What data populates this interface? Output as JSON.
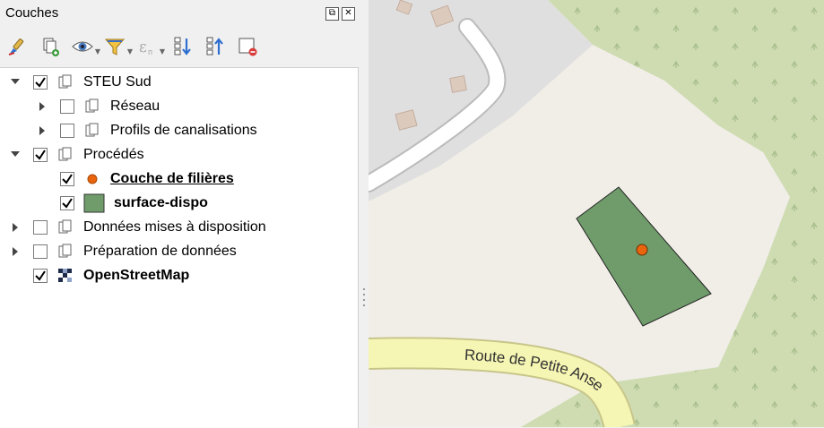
{
  "panel": {
    "title": "Couches",
    "float_button": "⧉",
    "close_button": "✕"
  },
  "toolbar": {
    "buttons": [
      {
        "icon": "style-brush-icon"
      },
      {
        "icon": "add-group-icon"
      },
      {
        "icon": "eye-visibility-icon"
      },
      {
        "icon": "filter-icon"
      },
      {
        "icon": "expression-filter-icon"
      },
      {
        "icon": "expand-all-icon"
      },
      {
        "icon": "collapse-all-icon"
      },
      {
        "icon": "remove-layer-icon"
      }
    ]
  },
  "layers": [
    {
      "label": "STEU Sud",
      "checked": true,
      "expanded": true,
      "type": "group",
      "level": 0
    },
    {
      "label": "Réseau",
      "checked": false,
      "expanded": false,
      "type": "group",
      "level": 1
    },
    {
      "label": "Profils de canalisations",
      "checked": false,
      "expanded": false,
      "type": "group",
      "level": 1
    },
    {
      "label": "Procédés",
      "checked": true,
      "expanded": true,
      "type": "group",
      "level": 0
    },
    {
      "label": "Couche de filières",
      "checked": true,
      "type": "point-layer",
      "level": 1,
      "bold": true,
      "underline": true,
      "symbol_color": "#e8650e"
    },
    {
      "label": "surface-dispo",
      "checked": true,
      "type": "polygon-layer",
      "level": 1,
      "bold": true,
      "symbol_color": "#6f9c6a"
    },
    {
      "label": "Données mises à disposition",
      "checked": false,
      "expanded": false,
      "type": "group",
      "level": 0
    },
    {
      "label": "Préparation de données",
      "checked": false,
      "expanded": false,
      "type": "group",
      "level": 0
    },
    {
      "label": "OpenStreetMap",
      "checked": true,
      "type": "raster-layer",
      "level": 0,
      "bold": true
    }
  ],
  "map": {
    "road_label": "Route de Petite Anse",
    "colors": {
      "land": "#f1eee8",
      "wood": "#cfdcb2",
      "residential": "#e0dfdf",
      "road": "#f6f6b4",
      "polygon_fill": "#6f9c6a",
      "point_fill": "#e8650e"
    }
  }
}
